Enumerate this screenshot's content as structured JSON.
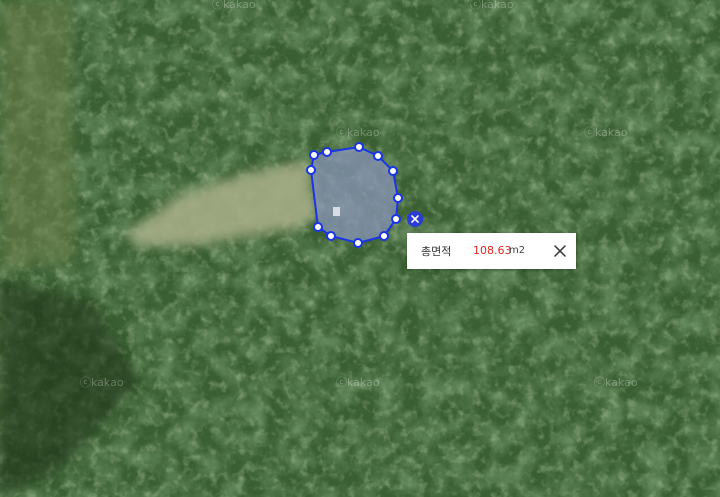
{
  "map": {
    "watermark_text": "ⓒkakao",
    "colors": {
      "forest_dark": "#2a4a26",
      "forest_mid": "#3d6534",
      "clearing": "#a9b08a",
      "polygon_stroke": "#1a34e8",
      "polygon_fill": "#8a95b8"
    }
  },
  "measurement": {
    "label": "총면적",
    "value": "108.63",
    "unit": "m2",
    "value_color": "#e2261f",
    "close_icon": "close-icon",
    "delete_vertex_icon": "close-icon"
  }
}
